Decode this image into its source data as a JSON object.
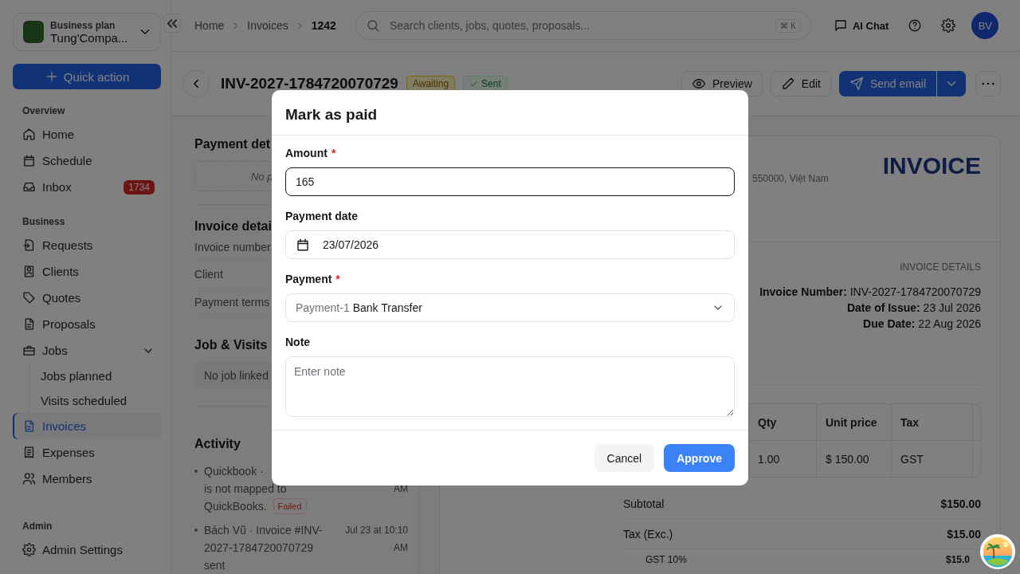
{
  "sidebar": {
    "plan": "Business plan",
    "workspace": "Tung'Compa...",
    "quick_action": "Quick action",
    "sections": [
      {
        "title": "Overview",
        "items": [
          {
            "label": "Home",
            "selected": false
          },
          {
            "label": "Schedule",
            "selected": false
          },
          {
            "label": "Inbox",
            "selected": false,
            "badge": "1734"
          }
        ]
      },
      {
        "title": "Business",
        "items": [
          {
            "label": "Requests",
            "selected": false
          },
          {
            "label": "Clients",
            "selected": false
          },
          {
            "label": "Quotes",
            "selected": false
          },
          {
            "label": "Proposals",
            "selected": false
          },
          {
            "label": "Jobs",
            "selected": false,
            "expanded": true,
            "children": [
              {
                "label": "Jobs planned",
                "selected": false
              },
              {
                "label": "Visits scheduled",
                "selected": false
              }
            ]
          },
          {
            "label": "Invoices",
            "selected": true
          },
          {
            "label": "Expenses",
            "selected": false
          },
          {
            "label": "Members",
            "selected": false
          }
        ]
      },
      {
        "title": "Admin",
        "items": [
          {
            "label": "Admin Settings",
            "selected": false
          }
        ]
      }
    ]
  },
  "topbar": {
    "breadcrumb": [
      {
        "label": "Home",
        "current": false
      },
      {
        "label": "Invoices",
        "current": false
      },
      {
        "label": "1242",
        "current": true
      }
    ],
    "search": {
      "placeholder": "Search clients, jobs, quotes, proposals...",
      "shortcut": "⌘ K"
    },
    "ai_chat": "AI Chat",
    "avatar": "BV"
  },
  "header": {
    "title": "INV-2027-1784720070729",
    "badges": [
      {
        "label": "Awaiting",
        "kind": "pending"
      },
      {
        "label": "Sent",
        "kind": "sent"
      }
    ],
    "actions": [
      {
        "label": "Preview",
        "primary": false
      },
      {
        "label": "Edit",
        "primary": false
      },
      {
        "label": "Send email",
        "primary": true
      }
    ]
  },
  "left": {
    "payment_title": "Payment det",
    "payment_empty": "No p",
    "details_title": "Invoice detai",
    "details_rows": [
      "Invoice number",
      "Client",
      "Payment terms"
    ],
    "job_title": "Job & Visits",
    "job_empty": "No job linked",
    "activity_title": "Activity",
    "activity": [
      {
        "lines": [
          "Quickbook ·",
          "is not mapped to",
          "QuickBooks."
        ],
        "status": "Failed",
        "time": "AM"
      },
      {
        "lines": [
          "Bách Vũ · Invoice #INV-2027-1784720070729 sent"
        ],
        "time": "Jul 23 at 10:10 AM"
      }
    ]
  },
  "invoice": {
    "heading": "INVOICE",
    "address": "550000, Việt Nam",
    "details_title": "INVOICE DETAILS",
    "details": [
      "**Invoice Number:** INV-2027-1784720070729",
      "**Date of Issue:** 23 Jul 2026",
      "**Due Date:** 22 Aug 2026"
    ],
    "table": {
      "columns": [
        "Qty",
        "Unit price",
        "Tax"
      ],
      "rows": [
        [
          "1.00",
          "$ 150.00",
          "GST"
        ]
      ]
    },
    "totals": [
      {
        "label": "Subtotal",
        "value": "$150.00",
        "kind": "main"
      },
      {
        "label": "Tax (Exc.)",
        "value": "$15.00",
        "kind": "main"
      },
      {
        "label": "GST 10%",
        "value": "$15.0",
        "kind": "sub"
      }
    ]
  },
  "modal": {
    "title": "Mark as paid",
    "fields": [
      {
        "kind": "text",
        "label": "Amount",
        "required_mark": "*",
        "value": "165",
        "focused": true
      },
      {
        "kind": "date",
        "label": "Payment date",
        "value": "23/07/2026",
        "focused": false
      },
      {
        "kind": "select",
        "label": "Payment",
        "required_mark": "*",
        "prefix": "Payment-1",
        "value": "Bank Transfer",
        "focused": false
      },
      {
        "kind": "textarea",
        "label": "Note",
        "placeholder": "Enter note",
        "focused": false
      }
    ],
    "buttons": [
      {
        "label": "Cancel",
        "primary": false
      },
      {
        "label": "Approve",
        "primary": true
      }
    ]
  }
}
